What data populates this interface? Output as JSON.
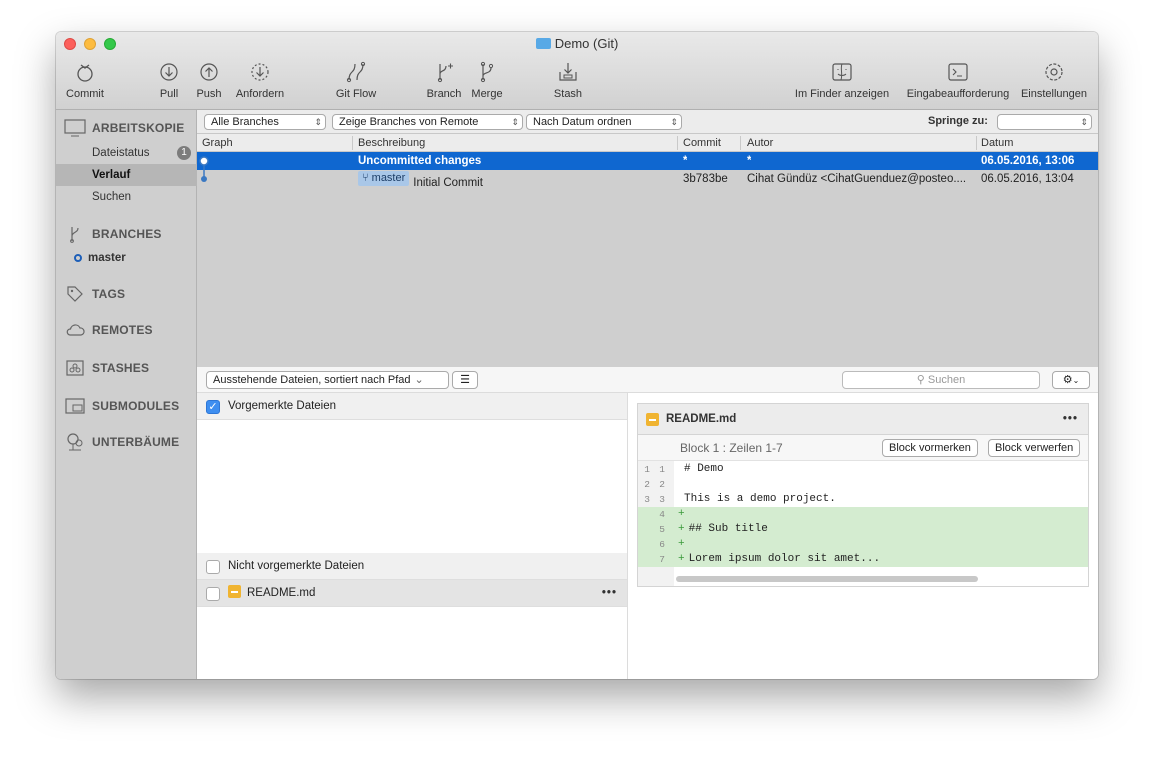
{
  "window": {
    "title": "Demo (Git)"
  },
  "toolbar": {
    "commit": "Commit",
    "pull": "Pull",
    "push": "Push",
    "fetch": "Anfordern",
    "gitflow": "Git Flow",
    "branch": "Branch",
    "merge": "Merge",
    "stash": "Stash",
    "finder": "Im Finder anzeigen",
    "terminal": "Eingabeaufforderung",
    "settings": "Einstellungen"
  },
  "sidebar": {
    "workspace": "ARBEITSKOPIE",
    "file_status": "Dateistatus",
    "file_status_badge": "1",
    "history": "Verlauf",
    "search": "Suchen",
    "branches": "BRANCHES",
    "current_branch": "master",
    "tags": "TAGS",
    "remotes": "REMOTES",
    "stashes": "STASHES",
    "submodules": "SUBMODULES",
    "subtrees": "UNTERBÄUME"
  },
  "filters": {
    "branches": "Alle Branches",
    "remote": "Zeige Branches von Remote",
    "order": "Nach Datum ordnen",
    "jump_label": "Springe zu:"
  },
  "history": {
    "columns": [
      "Graph",
      "Beschreibung",
      "Commit",
      "Autor",
      "Datum"
    ],
    "rows": [
      {
        "description": "Uncommitted changes",
        "branch": "",
        "commit": "*",
        "author": "*",
        "date": "06.05.2016, 13:06"
      },
      {
        "description": "Initial Commit",
        "branch": "master",
        "commit": "3b783be",
        "author": "Cihat Gündüz <CihatGuenduez@posteo....",
        "date": "06.05.2016, 13:04"
      }
    ]
  },
  "lower": {
    "files_select": "Ausstehende Dateien, sortiert nach Pfad",
    "search_placeholder": "Suchen",
    "staged_header": "Vorgemerkte Dateien",
    "unstaged_header": "Nicht vorgemerkte Dateien",
    "unstaged_file": "README.md",
    "more": "•••"
  },
  "diff": {
    "file": "README.md",
    "more": "•••",
    "hunk_label": "Block 1 : Zeilen 1-7",
    "stage_hunk": "Block vormerken",
    "discard_hunk": "Block verwerfen",
    "lines": [
      {
        "old": "1",
        "new": "1",
        "type": "ctx",
        "text": "# Demo"
      },
      {
        "old": "2",
        "new": "2",
        "type": "ctx",
        "text": ""
      },
      {
        "old": "3",
        "new": "3",
        "type": "ctx",
        "text": "This is a demo project."
      },
      {
        "old": "",
        "new": "4",
        "type": "add",
        "text": ""
      },
      {
        "old": "",
        "new": "5",
        "type": "add",
        "text": "## Sub title"
      },
      {
        "old": "",
        "new": "6",
        "type": "add",
        "text": ""
      },
      {
        "old": "",
        "new": "7",
        "type": "add",
        "text": "Lorem ipsum dolor sit amet..."
      }
    ]
  },
  "colors": {
    "selection": "#0f67d0",
    "added_line": "#d4ecd0",
    "sidebar": "#cfcfcf"
  }
}
